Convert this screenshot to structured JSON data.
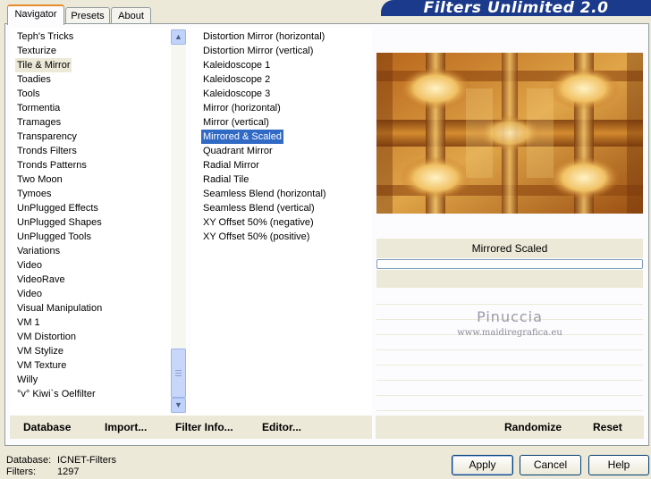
{
  "banner_title": "Filters Unlimited 2.0",
  "tabs": [
    {
      "label": "Navigator",
      "active": true
    },
    {
      "label": "Presets",
      "active": false
    },
    {
      "label": "About",
      "active": false
    }
  ],
  "categories": [
    {
      "label": "Teph's Tricks"
    },
    {
      "label": "Texturize"
    },
    {
      "label": "Tile & Mirror",
      "selected": true
    },
    {
      "label": "Toadies"
    },
    {
      "label": "Tools"
    },
    {
      "label": "Tormentia"
    },
    {
      "label": "Tramages"
    },
    {
      "label": "Transparency"
    },
    {
      "label": "Tronds Filters"
    },
    {
      "label": "Tronds Patterns"
    },
    {
      "label": "Two Moon"
    },
    {
      "label": "Tymoes"
    },
    {
      "label": "UnPlugged Effects"
    },
    {
      "label": "UnPlugged Shapes"
    },
    {
      "label": "UnPlugged Tools"
    },
    {
      "label": "Variations"
    },
    {
      "label": "Video"
    },
    {
      "label": "VideoRave"
    },
    {
      "label": "Video"
    },
    {
      "label": "Visual Manipulation"
    },
    {
      "label": "VM 1"
    },
    {
      "label": "VM Distortion"
    },
    {
      "label": "VM Stylize"
    },
    {
      "label": "VM Texture"
    },
    {
      "label": "Willy"
    },
    {
      "label": "°v° Kiwi`s Oelfilter"
    }
  ],
  "filters": [
    {
      "label": "Distortion Mirror (horizontal)"
    },
    {
      "label": "Distortion Mirror (vertical)"
    },
    {
      "label": "Kaleidoscope 1"
    },
    {
      "label": "Kaleidoscope 2"
    },
    {
      "label": "Kaleidoscope 3"
    },
    {
      "label": "Mirror (horizontal)"
    },
    {
      "label": "Mirror (vertical)"
    },
    {
      "label": "Mirrored & Scaled",
      "selected": true
    },
    {
      "label": "Quadrant Mirror"
    },
    {
      "label": "Radial Mirror"
    },
    {
      "label": "Radial Tile"
    },
    {
      "label": "Seamless Blend (horizontal)"
    },
    {
      "label": "Seamless Blend (vertical)"
    },
    {
      "label": "XY Offset 50% (negative)"
    },
    {
      "label": "XY Offset 50% (positive)"
    }
  ],
  "selected_filter_name": "Mirrored  Scaled",
  "watermark": {
    "line1": "Pinuccia",
    "line2": "www.maidiregrafica.eu"
  },
  "bottom_links": {
    "database": "Database",
    "import": "Import...",
    "filter_info": "Filter Info...",
    "editor": "Editor...",
    "randomize": "Randomize",
    "reset": "Reset"
  },
  "status": {
    "database_label": "Database:",
    "database_value": "ICNET-Filters",
    "filters_label": "Filters:",
    "filters_value": "1297"
  },
  "buttons": {
    "apply": "Apply",
    "cancel": "Cancel",
    "help": "Help"
  },
  "colors": {
    "banner": "#1b3a8c",
    "selection": "#316ac5",
    "tab_accent": "#e68b2c"
  }
}
